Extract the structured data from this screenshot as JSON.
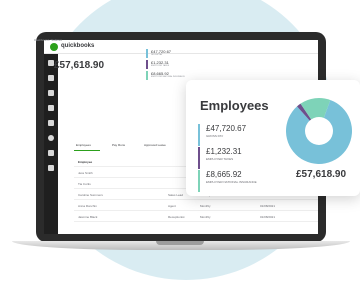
{
  "app": {
    "name": "quickbooks"
  },
  "breadcrumb": "Dashboard / Salaries",
  "summary": {
    "total": "£57,618.90",
    "items": [
      {
        "value": "£47,720.67",
        "label": "GROSS PAY",
        "color": "#78c1d9"
      },
      {
        "value": "£1,232.31",
        "label": "EMPLOYER TAXES",
        "color": "#6e4f8c"
      },
      {
        "value": "£8,665.92",
        "label": "EMPLOYER NATIONAL INSURANCE",
        "color": "#7ed3b8"
      }
    ]
  },
  "tabs": [
    "Employees",
    "Pay Runs",
    "Approved Leave"
  ],
  "table": {
    "header": "Employee",
    "rows": [
      {
        "name": "Jess Smith",
        "role": "",
        "type": "",
        "date": ""
      },
      {
        "name": "Tia Curtis",
        "role": "",
        "type": "",
        "date": ""
      },
      {
        "name": "Caroline Summers",
        "role": "Sales Lead",
        "type": "Monthly",
        "date": "01/08/2021"
      },
      {
        "name": "Anna Ronchin",
        "role": "Agent",
        "type": "Monthly",
        "date": "01/08/2021"
      },
      {
        "name": "Jasmine Black",
        "role": "Receptionist",
        "type": "Monthly",
        "date": "01/08/2021"
      }
    ]
  },
  "card": {
    "title": "Employees",
    "total": "£57,618.90",
    "items": [
      {
        "value": "£47,720.67",
        "label": "GROSS PAY",
        "color": "#78c1d9"
      },
      {
        "value": "£1,232.31",
        "label": "EMPLOYER TAXES",
        "color": "#6e4f8c"
      },
      {
        "value": "£8,665.92",
        "label": "EMPLOYER NATIONAL INSURANCE",
        "color": "#7ed3b8"
      }
    ]
  },
  "chart_data": {
    "type": "pie",
    "categories": [
      "Gross pay",
      "Employer taxes",
      "Employer national insurance"
    ],
    "values": [
      47720.67,
      1232.31,
      8665.92
    ],
    "colors": [
      "#78c1d9",
      "#6e4f8c",
      "#7ed3b8"
    ]
  },
  "sidebar_icons": [
    "dashboard-icon",
    "shield-icon",
    "chart-icon",
    "folder-icon",
    "plane-icon",
    "clock-icon",
    "leaf-icon",
    "document-icon"
  ]
}
